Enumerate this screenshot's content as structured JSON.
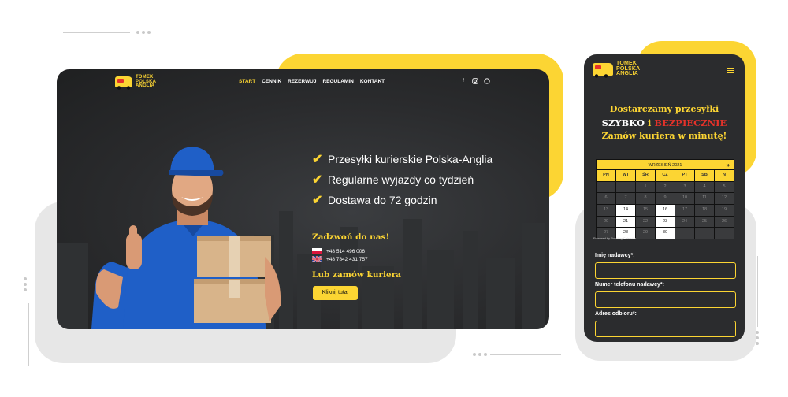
{
  "brand": {
    "logo_text": [
      "TOMEK",
      "POLSKA",
      "ANGLIA"
    ],
    "accent": "#fcd533",
    "dark": "#2b2c2e",
    "red": "#e5322a"
  },
  "desktop": {
    "nav": [
      "START",
      "CENNIK",
      "REZERWUJ",
      "REGULAMIN",
      "KONTAKT"
    ],
    "active_nav": "START",
    "social_icons": [
      "facebook-icon",
      "instagram-icon",
      "whatsapp-icon"
    ],
    "features": [
      "Przesyłki kurierskie Polska-Anglia",
      "Regularne wyjazdy co tydzień",
      "Dostawa do 72 godzin"
    ],
    "call_title": "Zadzwoń do nas!",
    "phones": [
      {
        "flag": "poland-flag-icon",
        "number": "+48 514 496 006"
      },
      {
        "flag": "uk-flag-icon",
        "number": "+48 7842 431 757"
      }
    ],
    "order_title": "Lub zamów kuriera",
    "cta_label": "Kliknij tutaj"
  },
  "mobile": {
    "headline1": "Dostarczamy przesyłki",
    "headline2": {
      "w1": "SZYBKO",
      "w2": "i",
      "w3": "BEZPIECZNIE"
    },
    "headline3": "Zamów kuriera w minutę!",
    "calendar": {
      "month": "WRZESIEŃ 2021",
      "next_icon": "»",
      "weekdays": [
        "PN",
        "WT",
        "ŚR",
        "CZ",
        "PT",
        "SB",
        "N"
      ],
      "weeks": [
        [
          "",
          "",
          "1",
          "2",
          "3",
          "4",
          "5"
        ],
        [
          "6",
          "7",
          "8",
          "9",
          "10",
          "11",
          "12"
        ],
        [
          "13",
          "14",
          "15",
          "16",
          "17",
          "18",
          "19"
        ],
        [
          "20",
          "21",
          "22",
          "23",
          "24",
          "25",
          "26"
        ],
        [
          "27",
          "28",
          "29",
          "30",
          "",
          "",
          ""
        ]
      ],
      "available_days": [
        "14",
        "16",
        "21",
        "23",
        "28",
        "30"
      ]
    },
    "powered_by": "Powered by Booking Calendar",
    "form": {
      "sender_name_label": "Imię nadawcy*:",
      "sender_phone_label": "Numer telefonu nadawcy*:",
      "pickup_address_label": "Adres odbioru*:"
    }
  }
}
